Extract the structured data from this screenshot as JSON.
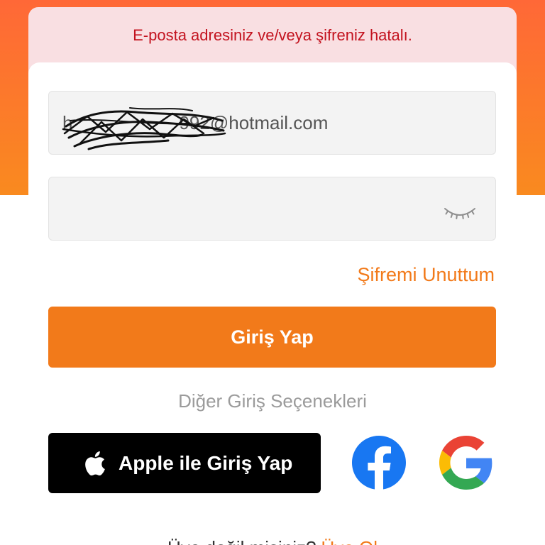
{
  "error_banner": {
    "message": "E-posta adresiniz ve/veya şifreniz hatalı."
  },
  "login_form": {
    "email": {
      "visible_start": "h",
      "visible_end": "992@hotmail.com"
    },
    "password": {
      "toggle_icon": "eye-closed-icon"
    },
    "forgot_password": "Şifremi Unuttum",
    "submit": "Giriş Yap"
  },
  "other_options": {
    "label": "Diğer Giriş Seçenekleri",
    "apple": {
      "icon": "apple-icon",
      "label": "Apple ile Giriş Yap"
    },
    "facebook": {
      "icon": "facebook-icon"
    },
    "google": {
      "icon": "google-icon"
    }
  },
  "signup": {
    "prompt": "Üye değil misiniz?",
    "link": "Üye Ol"
  },
  "colors": {
    "brand_orange": "#F27A1A",
    "error_text": "#C3131F",
    "error_background": "#F9DFE2",
    "facebook_blue": "#1877F2",
    "apple_black": "#000000",
    "header_gradient_top": "#FF6837",
    "header_gradient_bottom": "#F98A1F"
  }
}
